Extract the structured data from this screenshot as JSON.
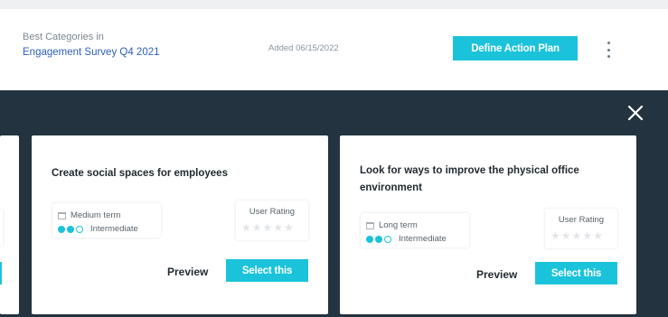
{
  "header": {
    "label": "Best Categories in",
    "survey": "Engagement Survey Q4 2021",
    "added": "Added 06/15/2022",
    "define_button": "Define Action Plan"
  },
  "cards": [
    {
      "title": "Create social spaces for employees",
      "term": "Medium term",
      "level": "Intermediate",
      "level_fraction": 0.67,
      "rating_label": "User Rating",
      "rating_value": 0,
      "rating_max": 5,
      "preview": "Preview",
      "select": "Select this"
    },
    {
      "title": "Look for ways to improve the physical office environment",
      "term": "Long term",
      "level": "Intermediate",
      "level_fraction": 0.67,
      "rating_label": "User Rating",
      "rating_value": 0,
      "rating_max": 5,
      "preview": "Preview",
      "select": "Select this"
    }
  ],
  "icons": {
    "close": "close-icon",
    "more": "more-vertical-icon",
    "calendar": "calendar-icon",
    "star": "star-icon"
  },
  "colors": {
    "accent": "#1bc3da",
    "panel": "#23333f",
    "link": "#2e5fb8"
  }
}
